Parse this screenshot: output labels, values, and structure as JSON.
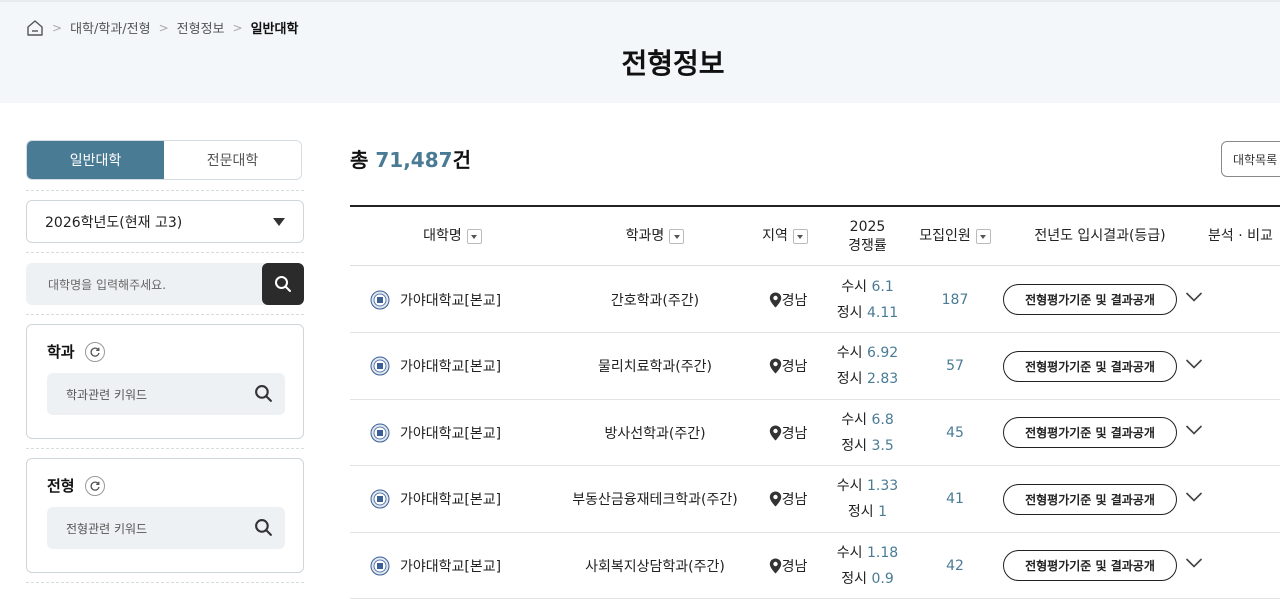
{
  "breadcrumb": [
    "대학/학과/전형",
    "전형정보",
    "일반대학"
  ],
  "page_title": "전형정보",
  "sidebar": {
    "tabs": [
      "일반대학",
      "전문대학"
    ],
    "year": "2026학년도(현재 고3)",
    "uni_placeholder": "대학명을 입력해주세요.",
    "dept": {
      "title": "학과",
      "placeholder": "학과관련 키워드"
    },
    "adm": {
      "title": "전형",
      "placeholder": "전형관련 키워드"
    }
  },
  "summary": {
    "prefix": "총 ",
    "count": "71,487",
    "suffix": "건"
  },
  "list_button": "대학목록",
  "columns": {
    "uni": "대학명",
    "dept": "학과명",
    "region": "지역",
    "comp_year": "2025",
    "comp_label": "경쟁률",
    "capacity": "모집인원",
    "result": "전년도 입시결과(등급)",
    "analysis": "분석 · 비교"
  },
  "rows": [
    {
      "uni": "가야대학교[본교]",
      "dept": "간호학과(주간)",
      "region": "경남",
      "susi_label": "수시 ",
      "susi": "6.1",
      "jeongsi_label": "정시 ",
      "jeongsi": "4.11",
      "capacity": "187",
      "result": "전형평가기준 및 결과공개"
    },
    {
      "uni": "가야대학교[본교]",
      "dept": "물리치료학과(주간)",
      "region": "경남",
      "susi_label": "수시 ",
      "susi": "6.92",
      "jeongsi_label": "정시 ",
      "jeongsi": "2.83",
      "capacity": "57",
      "result": "전형평가기준 및 결과공개"
    },
    {
      "uni": "가야대학교[본교]",
      "dept": "방사선학과(주간)",
      "region": "경남",
      "susi_label": "수시 ",
      "susi": "6.8",
      "jeongsi_label": "정시 ",
      "jeongsi": "3.5",
      "capacity": "45",
      "result": "전형평가기준 및 결과공개"
    },
    {
      "uni": "가야대학교[본교]",
      "dept": "부동산금융재테크학과(주간)",
      "region": "경남",
      "susi_label": "수시 ",
      "susi": "1.33",
      "jeongsi_label": "정시 ",
      "jeongsi": "1",
      "capacity": "41",
      "result": "전형평가기준 및 결과공개"
    },
    {
      "uni": "가야대학교[본교]",
      "dept": "사회복지상담학과(주간)",
      "region": "경남",
      "susi_label": "수시 ",
      "susi": "1.18",
      "jeongsi_label": "정시 ",
      "jeongsi": "0.9",
      "capacity": "42",
      "result": "전형평가기준 및 결과공개"
    }
  ],
  "colors": {
    "accent": "#4a7b95",
    "dark": "#2b2b2b"
  },
  "icons": {
    "home": "home-icon",
    "search": "search-icon",
    "reset": "refresh-icon",
    "location": "map-pin-icon",
    "expand": "chevron-down-icon",
    "logo": "university-seal-icon"
  }
}
